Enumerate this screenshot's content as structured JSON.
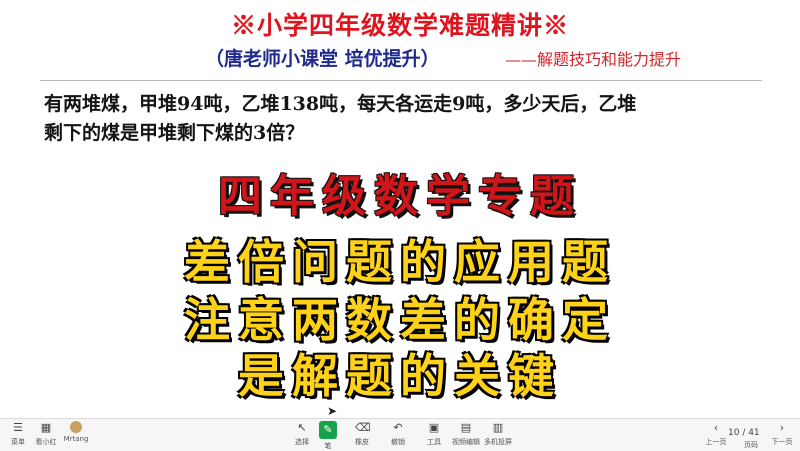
{
  "slide": {
    "title": "※小学四年级数学难题精讲※",
    "subtitle": "（唐老师小课堂 培优提升）",
    "tagline": "——解题技巧和能力提升",
    "question_line1": "有两堆煤，甲堆94吨，乙堆138吨，每天各运走9吨，多少天后，乙堆",
    "question_line2": "剩下的煤是甲堆剩下煤的3倍？",
    "banner": "四年级数学专题",
    "point1": "差倍问题的应用题",
    "point2": "注意两数差的确定",
    "point3": "是解题的关键"
  },
  "toolbar": {
    "left": [
      {
        "icon": "☰",
        "label": "菜单"
      },
      {
        "icon": "▦",
        "label": "看小红"
      },
      {
        "icon": "",
        "label": "Mrtang"
      }
    ],
    "center": [
      {
        "icon": "↖",
        "label": "选择"
      },
      {
        "icon": "✎",
        "label": "笔"
      },
      {
        "icon": "⌫",
        "label": "橡皮"
      },
      {
        "icon": "↶",
        "label": "撤销"
      },
      {
        "icon": "▣",
        "label": "工具"
      },
      {
        "icon": "▤",
        "label": "视频编辑"
      },
      {
        "icon": "▥",
        "label": "多机投屏"
      }
    ],
    "prev_label": "上一页",
    "pages_label": "页码",
    "next_label": "下一页",
    "page_indicator": "10 / 41"
  },
  "colors": {
    "title_red": "#e0141e",
    "subtitle_blue": "#1f2a8c",
    "highlight_yellow": "#ffd21a",
    "active_green": "#16a34a"
  }
}
